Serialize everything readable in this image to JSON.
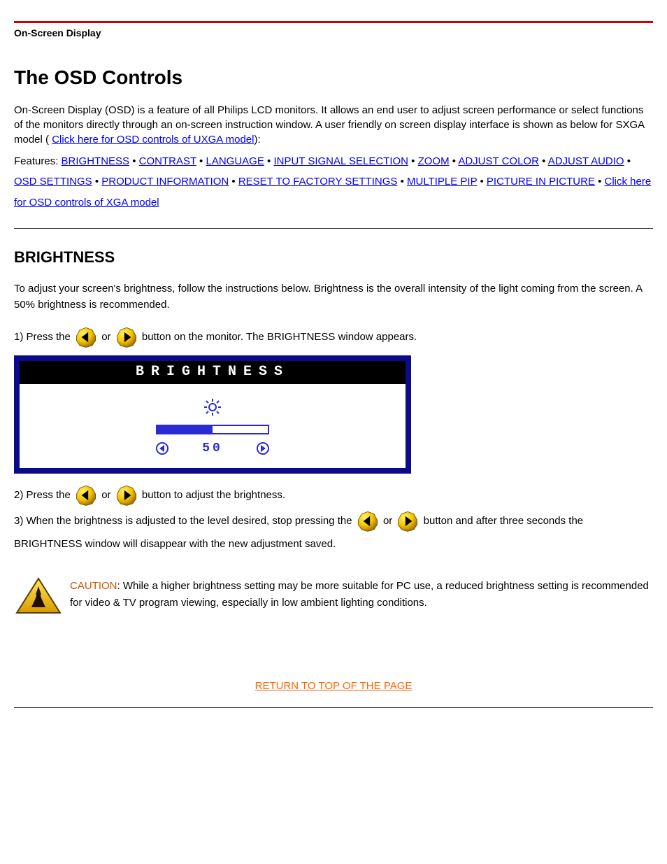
{
  "header": {
    "section_label": "On-Screen Display"
  },
  "title": "The OSD Controls",
  "intro": {
    "line1_before": "On-Screen Display (OSD) is a feature of all Philips LCD monitors. It allows an end user to adjust screen performance or select functions of the monitors directly through an on-screen instruction window. A user friendly on screen display interface is shown as below for SXGA model (",
    "link1": "Click here for OSD controls of UXGA model",
    "line1_after": "):"
  },
  "features": {
    "label": "Features:",
    "items": [
      "BRIGHTNESS",
      "CONTRAST",
      "LANGUAGE",
      "INPUT SIGNAL SELECTION",
      "ZOOM",
      "ADJUST COLOR",
      "ADJUST AUDIO",
      "OSD SETTINGS",
      "PRODUCT INFORMATION",
      "RESET TO FACTORY SETTINGS",
      "MULTIPLE PIP",
      "PICTURE IN PICTURE"
    ],
    "separator": " • ",
    "model_link": "Click here for OSD controls of XGA model"
  },
  "brightness": {
    "heading": "BRIGHTNESS",
    "para1": "To adjust your screen's brightness, follow the instructions below. Brightness is the overall intensity of the light coming from the screen. A 50% brightness is recommended.",
    "step1_before": "1) Press the ",
    "step1_middle": " or ",
    "step1_after": " button on the monitor. The BRIGHTNESS window appears.",
    "osd": {
      "title": "BRIGHTNESS",
      "value": "50",
      "progress_pct": 50
    },
    "step2_before": "2) Press the ",
    "step2_middle": " or ",
    "step2_after": " button to adjust the brightness.",
    "step3_before": "3) When the brightness is adjusted to the level desired, stop pressing the ",
    "step3_middle": " or ",
    "step3_after": " button and after three seconds the BRIGHTNESS window will disappear with the new adjustment saved."
  },
  "caution": {
    "label": "CAUTION",
    "text": ": While a higher brightness setting may be more suitable for PC use, a reduced brightness setting is recommended for video & TV program viewing, especially in low ambient lighting conditions."
  },
  "footer": {
    "return_link": "RETURN TO TOP OF THE PAGE"
  },
  "icons": {
    "left_arrow": "left-arrow-icon",
    "right_arrow": "right-arrow-icon",
    "caution": "caution-icon",
    "sun": "sun-icon"
  }
}
